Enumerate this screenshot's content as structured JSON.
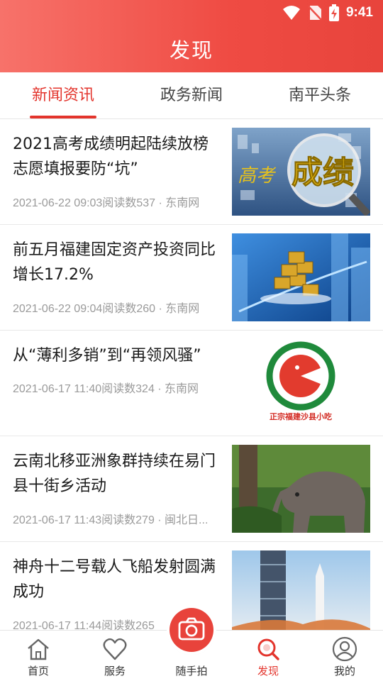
{
  "status_bar": {
    "time": "9:41"
  },
  "header": {
    "title": "发现"
  },
  "tabs": [
    {
      "label": "新闻资讯",
      "active": true
    },
    {
      "label": "政务新闻",
      "active": false
    },
    {
      "label": "南平头条",
      "active": false
    }
  ],
  "news": [
    {
      "title": "2021高考成绩明起陆续放榜 志愿填报要防“坑”",
      "meta": "2021-06-22 09:03阅读数537 · 东南网",
      "thumb_text_left": "高考",
      "thumb_text_right": "成绩"
    },
    {
      "title": "前五月福建固定资产投资同比增长17.2%",
      "meta": "2021-06-22 09:04阅读数260 · 东南网"
    },
    {
      "title": "从“薄利多销”到“再领风骚”",
      "meta": "2021-06-17 11:40阅读数324 · 东南网",
      "thumb_caption": "正宗福建沙县小吃"
    },
    {
      "title": "云南北移亚洲象群持续在易门县十街乡活动",
      "meta": "2021-06-17 11:43阅读数279 · 闽北日..."
    },
    {
      "title": "神舟十二号载人飞船发射圆满成功",
      "meta": "2021-06-17 11:44阅读数265"
    }
  ],
  "bottom_nav": [
    {
      "label": "首页",
      "icon": "home-icon"
    },
    {
      "label": "服务",
      "icon": "heart-icon"
    },
    {
      "label": "随手拍",
      "icon": "camera-icon"
    },
    {
      "label": "发现",
      "icon": "discover-icon",
      "active": true
    },
    {
      "label": "我的",
      "icon": "user-icon"
    }
  ],
  "colors": {
    "accent": "#e3342c",
    "header_start": "#f7726a",
    "header_end": "#e8443c"
  }
}
